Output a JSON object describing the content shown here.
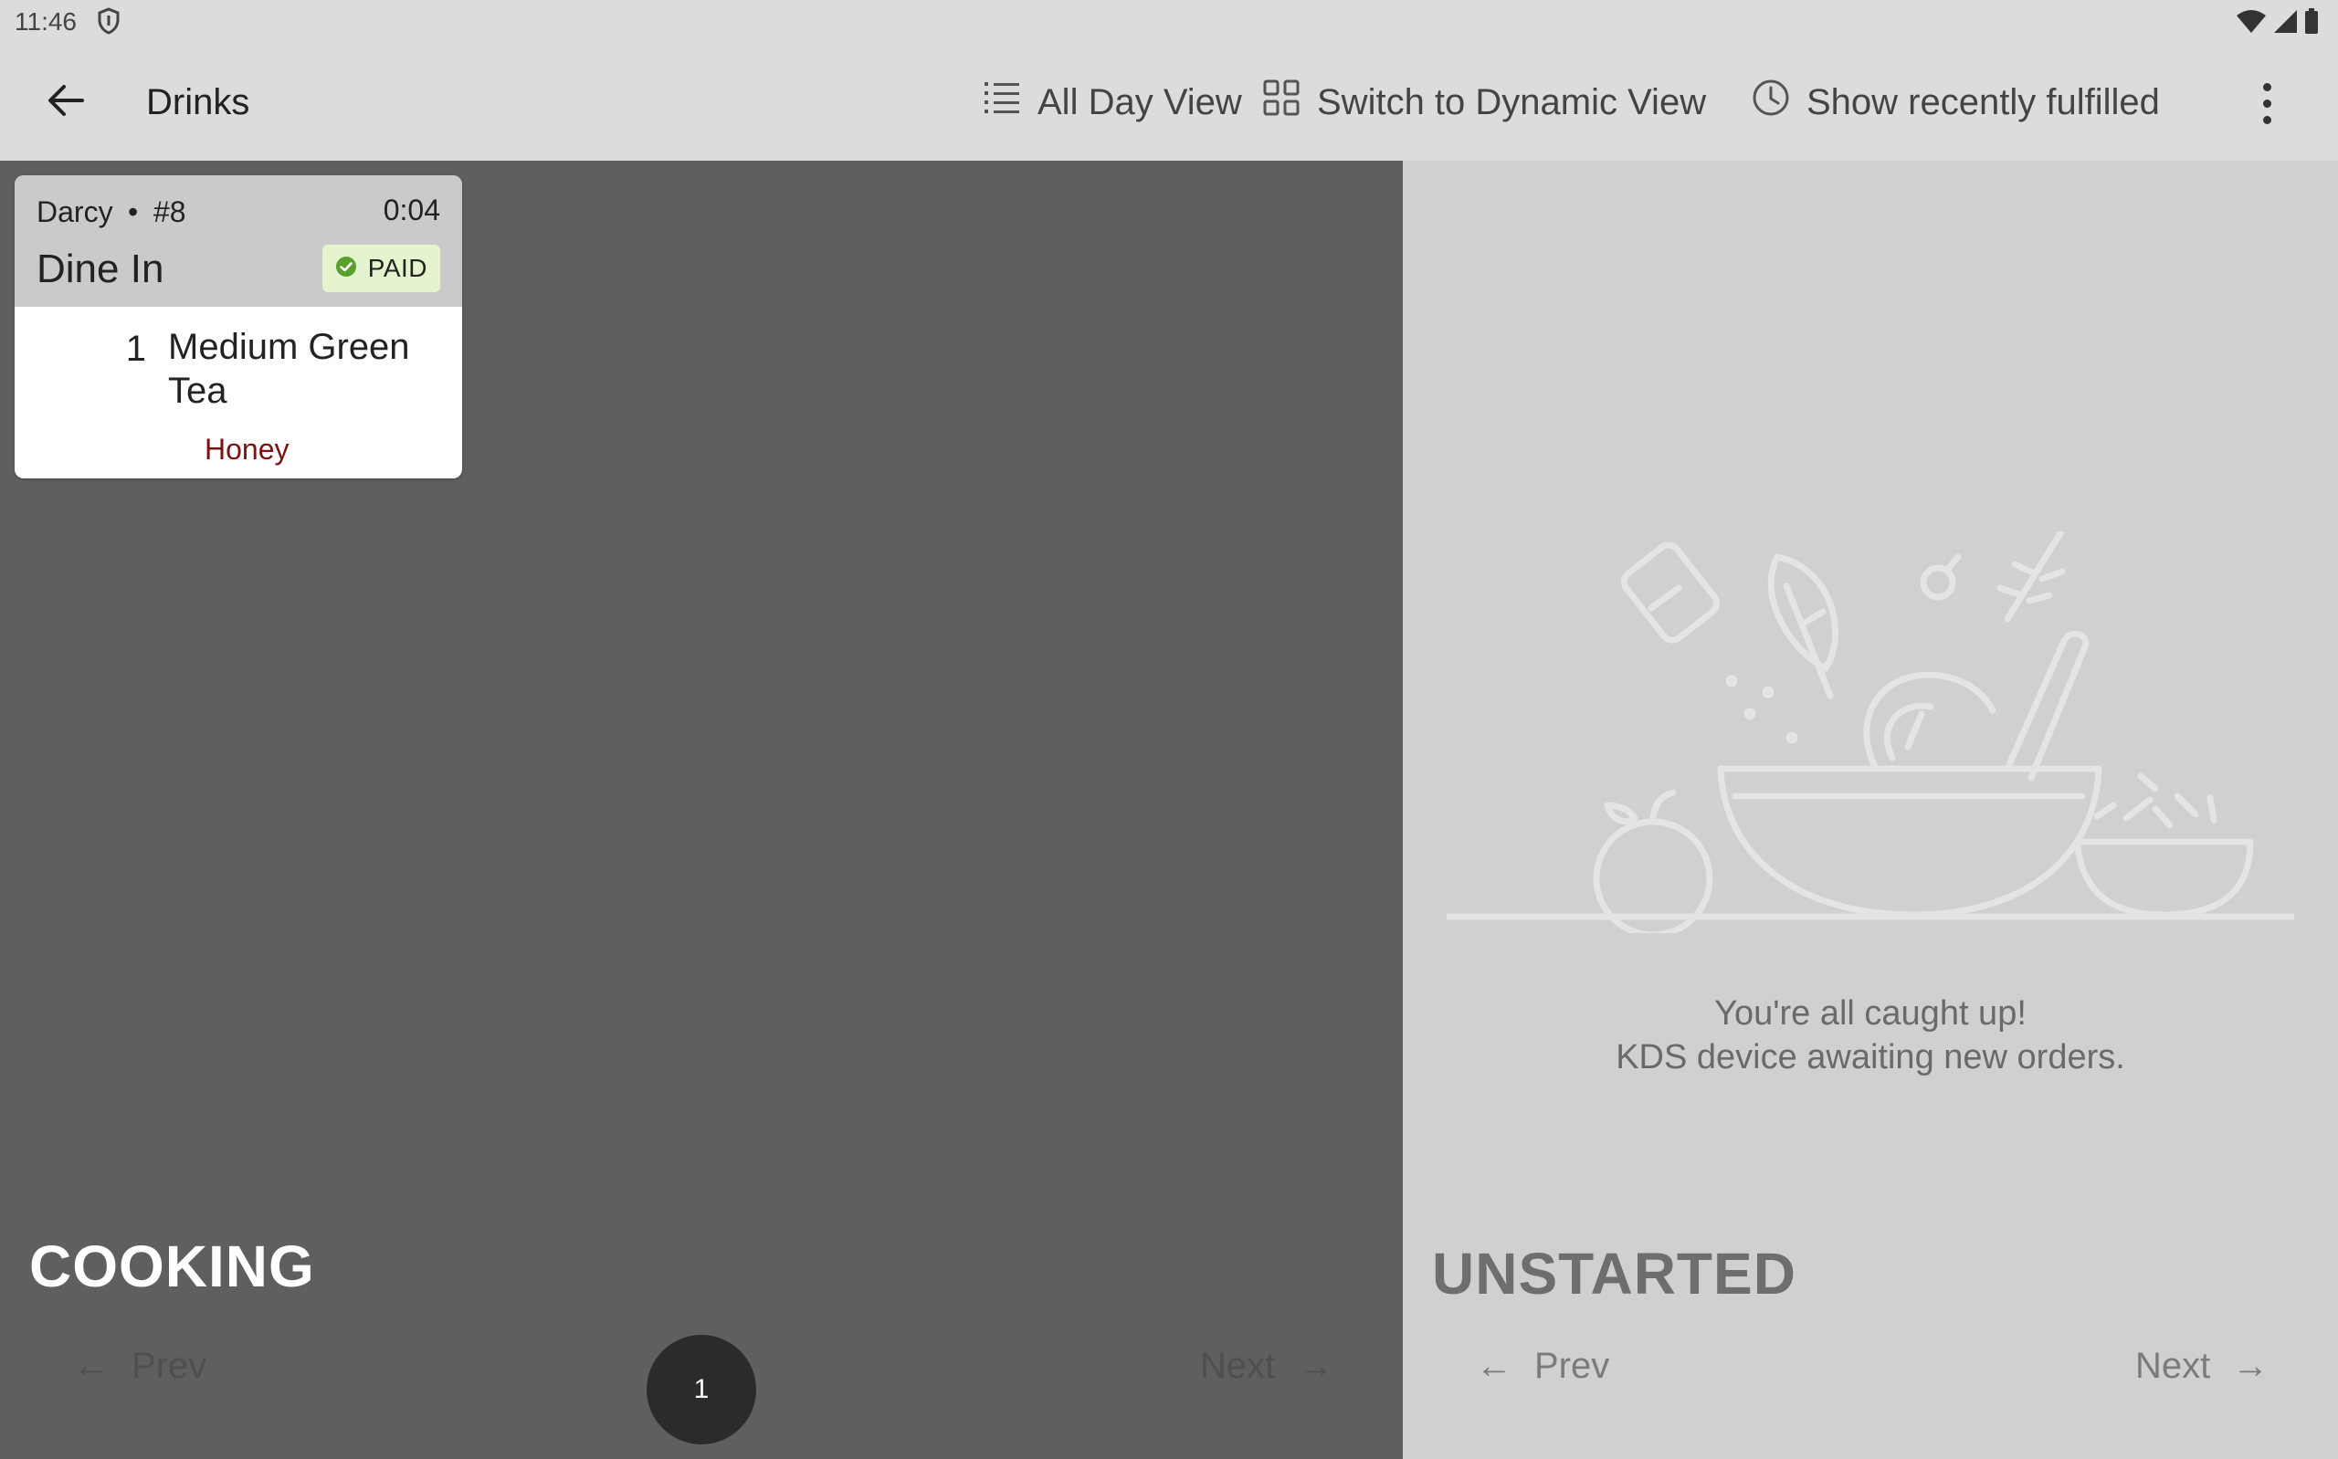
{
  "status_bar": {
    "time": "11:46"
  },
  "app_bar": {
    "title": "Drinks",
    "actions": {
      "all_day": "All Day View",
      "dynamic": "Switch to Dynamic View",
      "recent": "Show recently fulfilled"
    }
  },
  "cooking": {
    "label": "COOKING",
    "ticket": {
      "customer": "Darcy",
      "separator": "•",
      "number": "#8",
      "elapsed": "0:04",
      "order_type": "Dine In",
      "payment_status": "PAID",
      "items": [
        {
          "qty": "1",
          "name": "Medium Green Tea",
          "modifier": "Honey"
        }
      ]
    },
    "pager": {
      "prev": "Prev",
      "next": "Next",
      "page": "1"
    }
  },
  "unstarted": {
    "label": "UNSTARTED",
    "empty_line1": "You're all caught up!",
    "empty_line2": "KDS device awaiting new orders.",
    "pager": {
      "prev": "Prev",
      "next": "Next"
    }
  },
  "colors": {
    "cooking_bg": "#5f5f5f",
    "unstarted_bg": "#d0d0d0",
    "paid_badge_bg": "#e3f4cf",
    "paid_check": "#5aa02c",
    "modifier_text": "#7a1212"
  }
}
